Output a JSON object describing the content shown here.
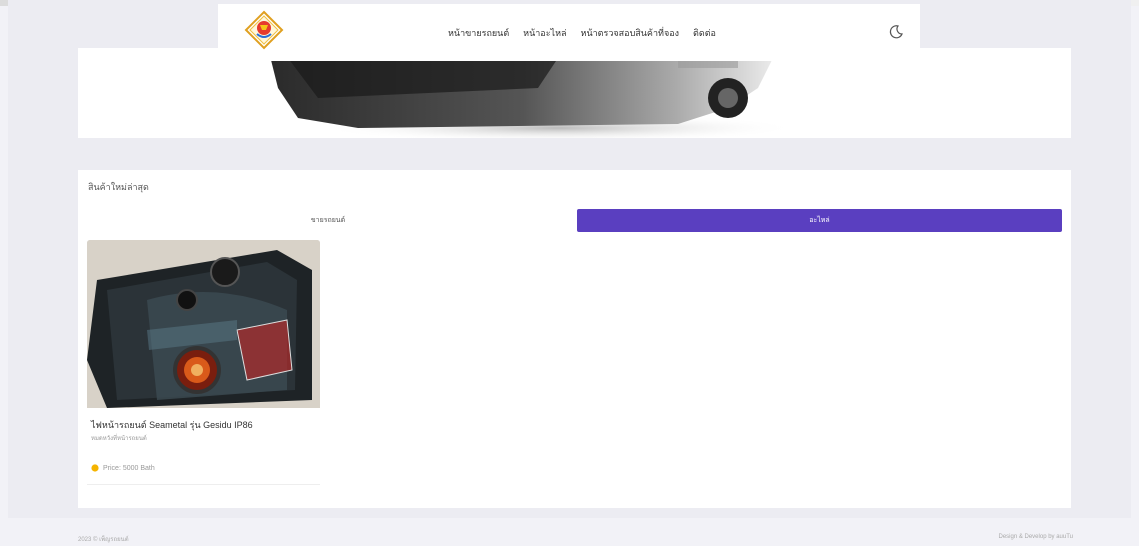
{
  "nav": {
    "links": [
      "หน้าขายรถยนต์",
      "หน้าอะไหล่",
      "หน้าตรวจสอบสินค้าที่จอง",
      "ติดต่อ"
    ]
  },
  "products_section": {
    "title": "สินค้าใหม่ล่าสุด",
    "tabs": [
      {
        "label": "ขายรถยนต์",
        "active": false
      },
      {
        "label": "อะไหล่",
        "active": true
      }
    ],
    "items": [
      {
        "name": "ไฟหน้ารถยนต์ Seametal รุ่น Gesidu IP86",
        "category": "หมดหวังที่หน้ารถยนต์",
        "price": "Price: 5000 Bath"
      }
    ]
  },
  "footer": {
    "left": "2023 © เพ็ญรถยนต์",
    "right": "Design & Develop by auuTu"
  },
  "colors": {
    "accent": "#5a3fc0",
    "background": "#f2f2f7",
    "star": "#f5b400"
  },
  "icons": {
    "logo": "diamond-logo",
    "theme": "moon-icon",
    "price": "star-icon"
  }
}
